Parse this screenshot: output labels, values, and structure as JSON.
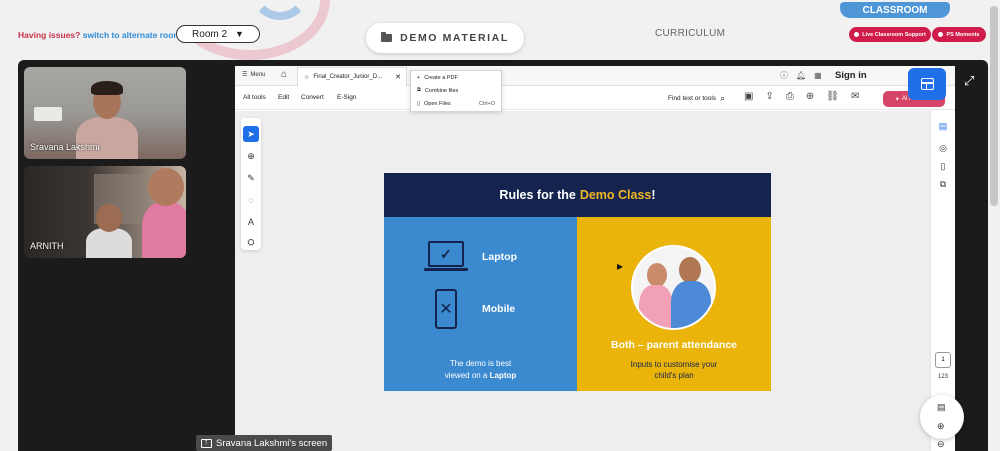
{
  "header": {
    "issues_text": "Having issues?",
    "alt_room_link": "switch to alternate room",
    "room_selected": "Room 2",
    "demo_material": "DEMO MATERIAL",
    "curriculum": "CURRICULUM",
    "classroom_tab": "CLASSROOM",
    "live_support": "Live Classroom Support",
    "ps_moments": "PS Moments"
  },
  "participants": [
    {
      "name": "Sravana Lakshmi"
    },
    {
      "name": "ARNITH"
    }
  ],
  "screen_share_label": "Sravana Lakshmi's screen",
  "app": {
    "menu_label": "Menu",
    "doc_tab": "Final_Creator_Junior_D...",
    "new_tab_menu": [
      {
        "label": "Create a PDF",
        "shortcut": ""
      },
      {
        "label": "Combine files",
        "shortcut": ""
      },
      {
        "label": "Open Files",
        "shortcut": "Ctrl+O"
      }
    ],
    "sign_in": "Sign in",
    "menubar": [
      "All tools",
      "Edit",
      "Convert",
      "E-Sign"
    ],
    "find_label": "Find text or tools",
    "ai_button": "AI Assistant",
    "page_number": "1",
    "page_total": "123"
  },
  "slide": {
    "title_prefix": "Rules for the",
    "title_highlight": "Demo Class",
    "title_suffix": "!",
    "laptop_label": "Laptop",
    "mobile_label": "Mobile",
    "note_line1": "The demo is best",
    "note_line2_prefix": "viewed on a",
    "note_line2_bold": "Laptop",
    "both_label": "Both – parent attendance",
    "both_note_line1": "Inputs to customise your",
    "both_note_line2": "child's plan"
  },
  "colors": {
    "brand_red": "#d01c4a",
    "brand_blue": "#4e96d6",
    "slide_navy": "#14244e",
    "slide_blue": "#3b89cf",
    "slide_yellow": "#eab40a",
    "highlight_yellow": "#f0b824"
  }
}
